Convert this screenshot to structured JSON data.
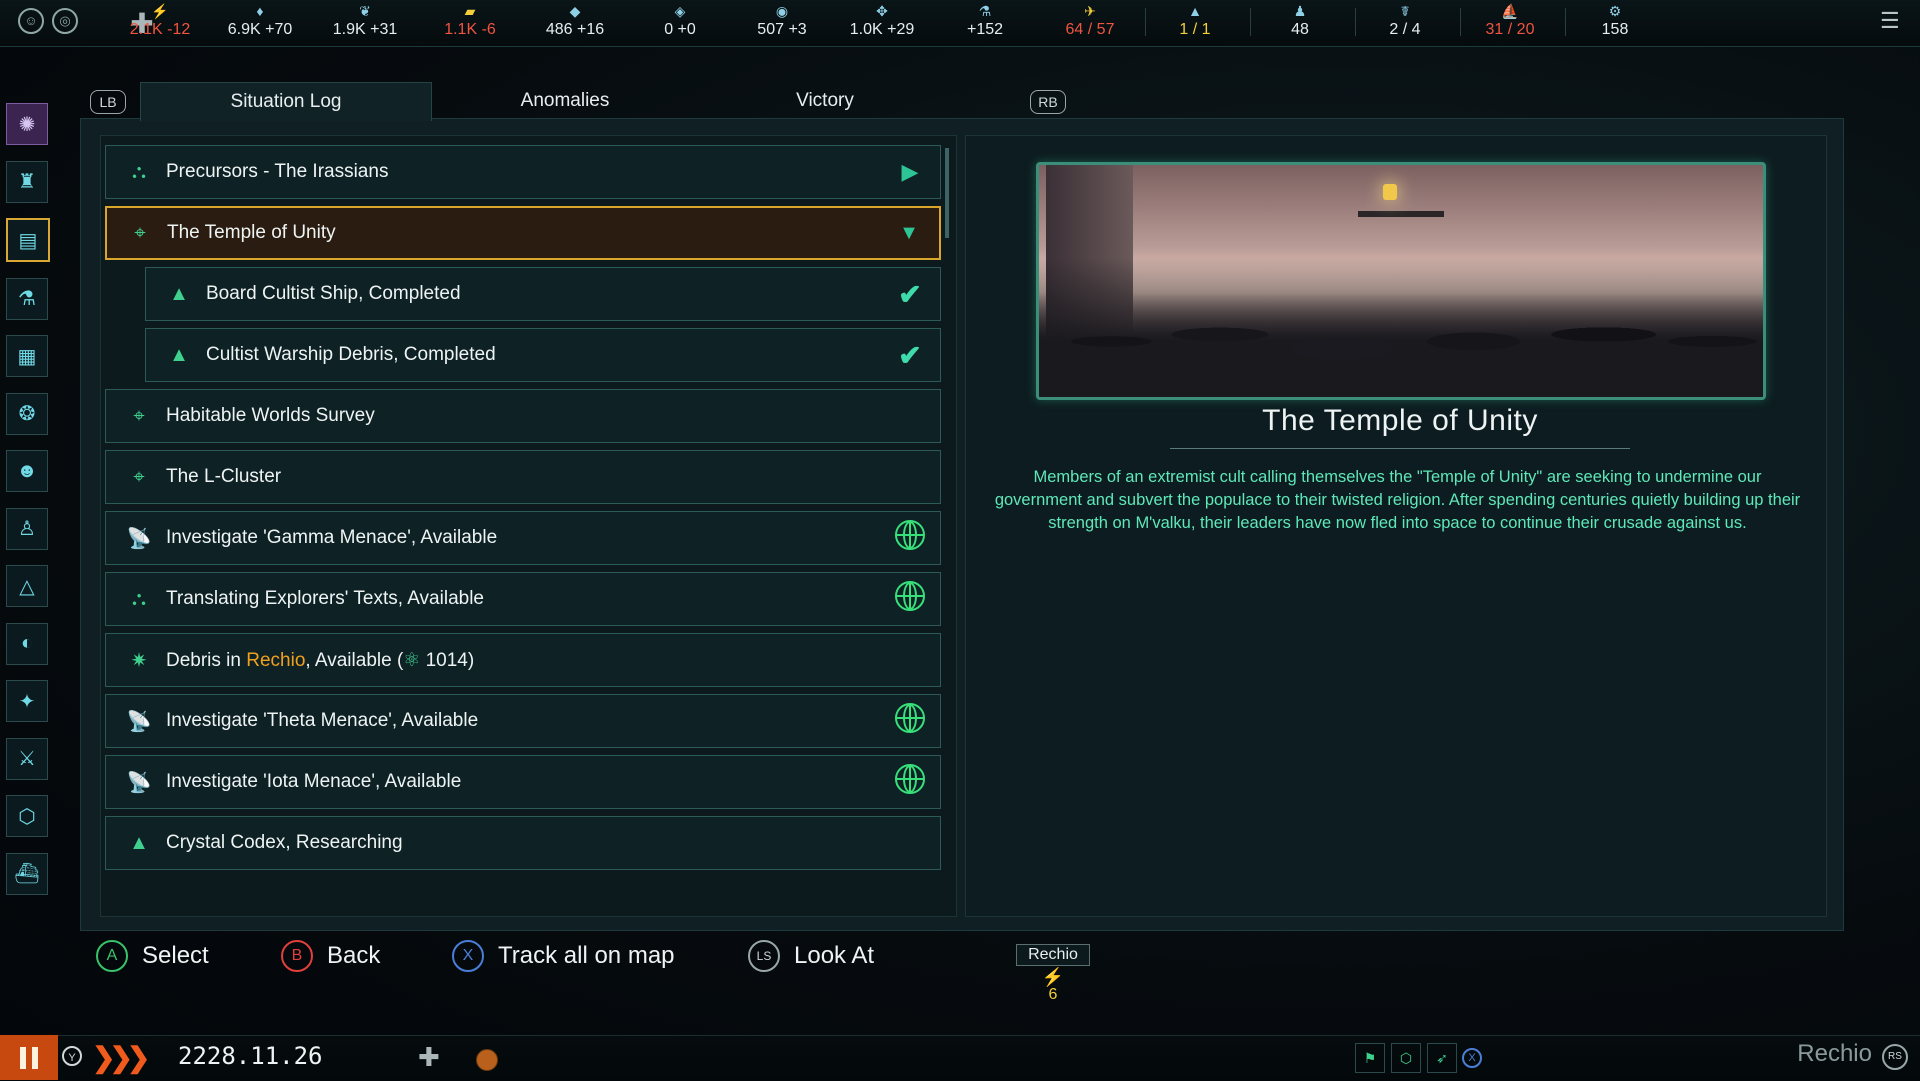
{
  "resources": [
    {
      "icon": "energy-icon",
      "value": "2.1K -12",
      "alert": true
    },
    {
      "icon": "minerals-icon",
      "value": "6.9K +70",
      "alert": false
    },
    {
      "icon": "food-icon",
      "value": "1.9K +31",
      "alert": false
    },
    {
      "icon": "alloys-icon",
      "value": "1.1K -6",
      "alert": true
    },
    {
      "icon": "consumer-goods-icon",
      "value": "486 +16",
      "alert": false
    },
    {
      "icon": "strategic-resource-icon",
      "value": "0 +0",
      "alert": false
    },
    {
      "icon": "influence-icon",
      "value": "507 +3",
      "alert": false
    },
    {
      "icon": "unity-icon",
      "value": "1.0K +29",
      "alert": false
    },
    {
      "icon": "research-icon",
      "value": "+152",
      "alert": false
    },
    {
      "icon": "naval-capacity-icon",
      "value": "64 / 57",
      "alert": true
    },
    {
      "icon": "starbase-icon",
      "value": "1 / 1",
      "alert": false,
      "yellow": true
    },
    {
      "icon": "population-icon",
      "value": "48",
      "alert": false
    },
    {
      "icon": "envoys-icon",
      "value": "2 / 4",
      "alert": false
    },
    {
      "icon": "fleet-icon",
      "value": "31 / 20",
      "alert": true
    },
    {
      "icon": "planets-icon",
      "value": "158",
      "alert": false
    }
  ],
  "tabs": {
    "lb": "LB",
    "rb": "RB",
    "items": [
      "Situation Log",
      "Anomalies",
      "Victory"
    ]
  },
  "log_items": [
    {
      "icon": "precursor-icon",
      "text": "Precursors - The Irassians",
      "right": "arrow",
      "level": 0
    },
    {
      "icon": "location-pin-icon",
      "text": "The Temple of Unity",
      "right": "arrow-down",
      "level": 0,
      "selected": true
    },
    {
      "icon": "warning-icon",
      "text": "Board Cultist Ship, Completed",
      "right": "check",
      "level": 1
    },
    {
      "icon": "warning-icon",
      "text": "Cultist Warship Debris, Completed",
      "right": "check",
      "level": 1
    },
    {
      "icon": "location-pin-icon",
      "text": "Habitable Worlds Survey",
      "right": "",
      "level": 0
    },
    {
      "icon": "location-pin-icon",
      "text": "The L-Cluster",
      "right": "",
      "level": 0
    },
    {
      "icon": "satellite-dish-icon",
      "text": "Investigate 'Gamma Menace', Available",
      "right": "globe",
      "level": 0
    },
    {
      "icon": "precursor-icon",
      "text": "Translating Explorers' Texts, Available",
      "right": "globe",
      "level": 0
    },
    {
      "icon": "debris-icon",
      "text_before": "Debris in ",
      "text_highlight": "Rechio",
      "text_after": ", Available (",
      "text_value": "1014",
      "text_end": ")",
      "right": "",
      "level": 0
    },
    {
      "icon": "satellite-dish-icon",
      "text": "Investigate 'Theta Menace', Available",
      "right": "globe",
      "level": 0
    },
    {
      "icon": "satellite-dish-icon",
      "text": "Investigate 'Iota Menace', Available",
      "right": "globe",
      "level": 0
    },
    {
      "icon": "warning-icon",
      "text": "Crystal Codex, Researching",
      "right": "",
      "level": 0
    }
  ],
  "detail": {
    "title": "The Temple of Unity",
    "description": "Members of an extremist cult calling themselves the \"Temple of Unity\" are seeking to undermine our government and subvert the populace to their twisted religion. After spending centuries quietly building up their strength on M'valku, their leaders have now fled into space to continue their crusade against us."
  },
  "prompts": [
    {
      "glyph": "A",
      "label": "Select"
    },
    {
      "glyph": "B",
      "label": "Back"
    },
    {
      "glyph": "X",
      "label": "Track all on map"
    },
    {
      "glyph": "LS",
      "label": "Look At"
    }
  ],
  "map_tooltip": {
    "name": "Rechio",
    "value": "6"
  },
  "bottom": {
    "speed_button": "Y",
    "date": "2228.11.26",
    "x_button": "X",
    "location": "Rechio",
    "rs_button": "RS"
  },
  "colors": {
    "accent_green": "#3fd08e",
    "selected_border": "#d9a62c",
    "alert_red": "#f05440",
    "highlight_orange": "#f0a020",
    "description_text": "#5fe8b8"
  }
}
